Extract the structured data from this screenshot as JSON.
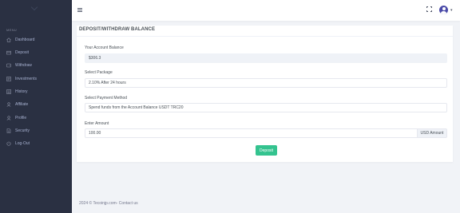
{
  "sidebar": {
    "menu_title": "MENU",
    "items": [
      {
        "label": "Dashboard",
        "icon": "dashboard-icon"
      },
      {
        "label": "Deposit",
        "icon": "wallet-icon"
      },
      {
        "label": "Withdraw",
        "icon": "withdraw-icon"
      },
      {
        "label": "Investments",
        "icon": "investments-icon"
      },
      {
        "label": "History",
        "icon": "history-icon"
      },
      {
        "label": "Affiliate",
        "icon": "affiliate-icon"
      },
      {
        "label": "Profile",
        "icon": "profile-icon"
      },
      {
        "label": "Security",
        "icon": "security-icon"
      },
      {
        "label": "Log-Out",
        "icon": "logout-icon"
      }
    ]
  },
  "topbar": {
    "menu_icon": "hamburger-icon",
    "fullscreen_icon": "fullscreen-icon",
    "avatar_icon": "user-avatar-icon",
    "caret_icon": "chevron-down-icon"
  },
  "card": {
    "title": "DEPOSIT/WITHDRAW BALANCE",
    "balance_label": "Your Account Balance",
    "balance_value": "$306.3",
    "package_label": "Select Package",
    "package_value": "2.10% After 24 hours",
    "payment_label": "Select Payment Method",
    "payment_value": "Spend funds from the Account Balance USDT TRC20",
    "amount_label": "Enter Amount",
    "amount_value": "100.00",
    "amount_addon": "USD Amount",
    "submit_label": "Deposit"
  },
  "footer": {
    "text": "2024 © Tecoinjp.com- Contact us"
  },
  "colors": {
    "sidebar_bg": "#2a3042",
    "accent_green": "#34c38f",
    "avatar": "#4a4aa8",
    "page_bg": "#f1f3f7"
  }
}
